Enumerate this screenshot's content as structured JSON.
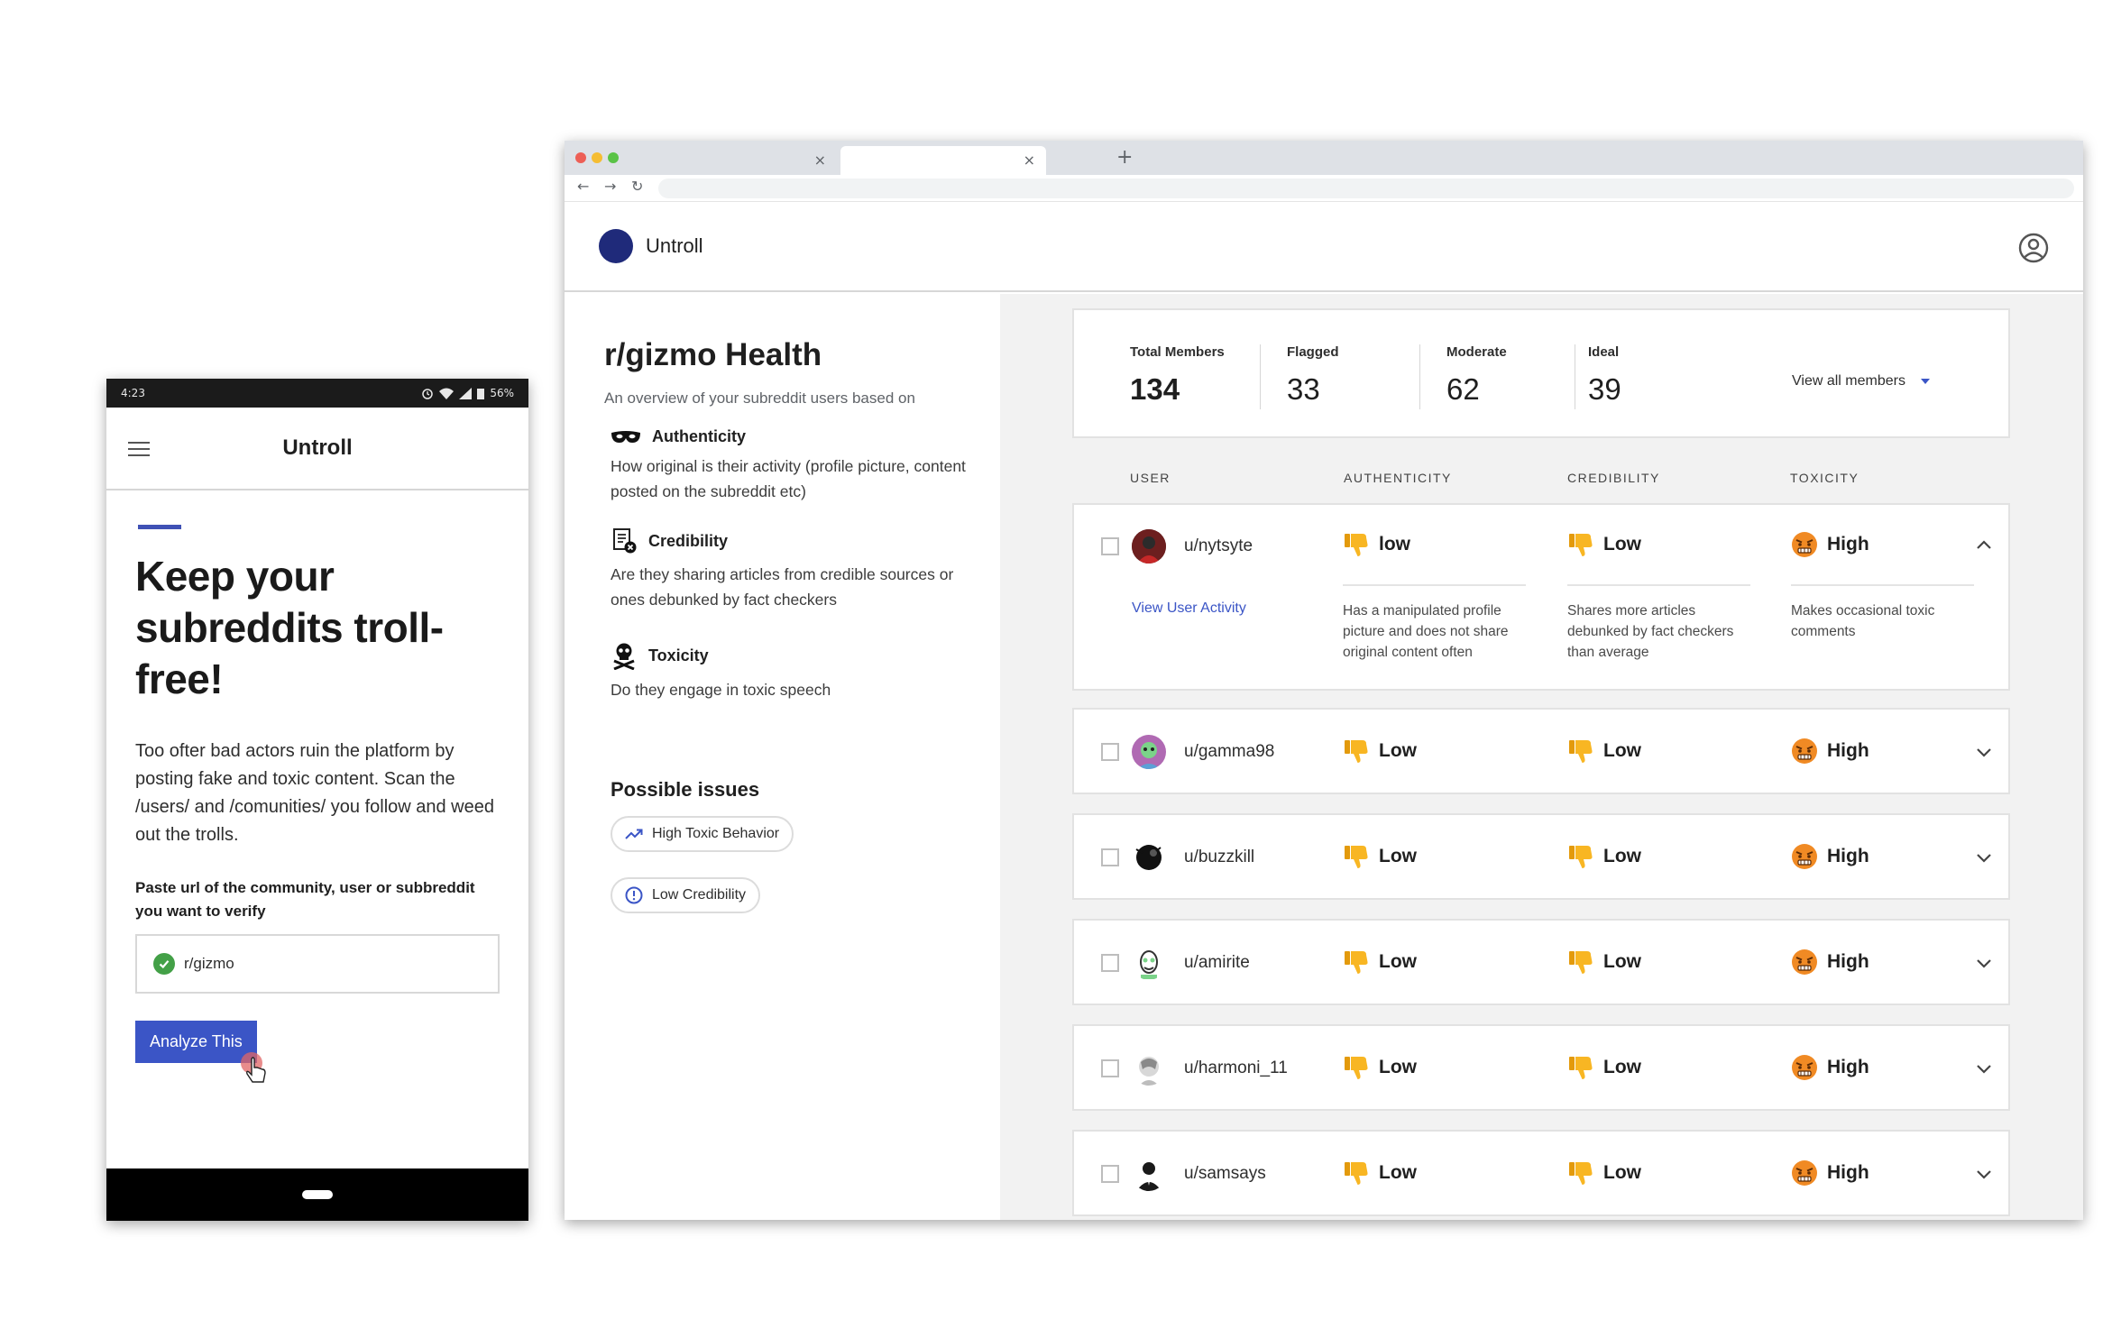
{
  "phone": {
    "status": {
      "time": "4:23",
      "battery": "56%"
    },
    "app_title": "Untroll",
    "hero": "Keep your subreddits troll-free!",
    "intro": "Too ofter bad actors ruin the platform by posting fake and toxic content. Scan the /users/ and /comunities/ you follow and weed out the trolls.",
    "paste_label": "Paste url of the community, user or subbreddit you want to verify",
    "url_value": "r/gizmo",
    "analyze_button": "Analyze This"
  },
  "browser": {
    "new_tab": "+",
    "close_glyph": "×",
    "back": "←",
    "forward": "→",
    "reload": "↻"
  },
  "dashboard": {
    "brand": "Untroll",
    "title": "r/gizmo Health",
    "subtitle": "An overview of your subreddit users based on",
    "metrics": [
      {
        "icon": "mask-icon",
        "title": "Authenticity",
        "desc": "How original is their activity (profile picture, content posted on the subreddit etc)"
      },
      {
        "icon": "document-x-icon",
        "title": "Credibility",
        "desc": "Are they sharing articles from credible sources or ones debunked by fact checkers"
      },
      {
        "icon": "skull-crossbones-icon",
        "title": "Toxicity",
        "desc": "Do they engage in toxic speech"
      }
    ],
    "issues_title": "Possible issues",
    "issues": [
      {
        "icon": "trending-up-icon",
        "label": "High Toxic Behavior"
      },
      {
        "icon": "info-circle-icon",
        "label": "Low Credibility"
      }
    ],
    "stats": [
      {
        "label": "Total Members",
        "value": "134"
      },
      {
        "label": "Flagged",
        "value": "33"
      },
      {
        "label": "Moderate",
        "value": "62"
      },
      {
        "label": "Ideal",
        "value": "39"
      }
    ],
    "view_all": "View all members",
    "columns": [
      "USER",
      "AUTHENTICITY",
      "CREDIBILITY",
      "TOXICITY"
    ],
    "expanded_row": {
      "user": "u/nytsyte",
      "authenticity": "low",
      "credibility": "Low",
      "toxicity": "High",
      "view_activity": "View User Activity",
      "auth_detail": "Has a manipulated profile picture and does not share original content often",
      "cred_detail": "Shares more articles debunked by fact checkers than average",
      "tox_detail": "Makes occasional toxic comments"
    },
    "rows": [
      {
        "user": "u/gamma98",
        "authenticity": "Low",
        "credibility": "Low",
        "toxicity": "High"
      },
      {
        "user": "u/buzzkill",
        "authenticity": "Low",
        "credibility": "Low",
        "toxicity": "High"
      },
      {
        "user": "u/amirite",
        "authenticity": "Low",
        "credibility": "Low",
        "toxicity": "High"
      },
      {
        "user": "u/harmoni_11",
        "authenticity": "Low",
        "credibility": "Low",
        "toxicity": "High"
      },
      {
        "user": "u/samsays",
        "authenticity": "Low",
        "credibility": "Low",
        "toxicity": "High"
      }
    ],
    "colors": {
      "accent": "#3b55c6",
      "brand_dot": "#1f2a7a",
      "panel_bg": "#f2f2f2"
    }
  }
}
